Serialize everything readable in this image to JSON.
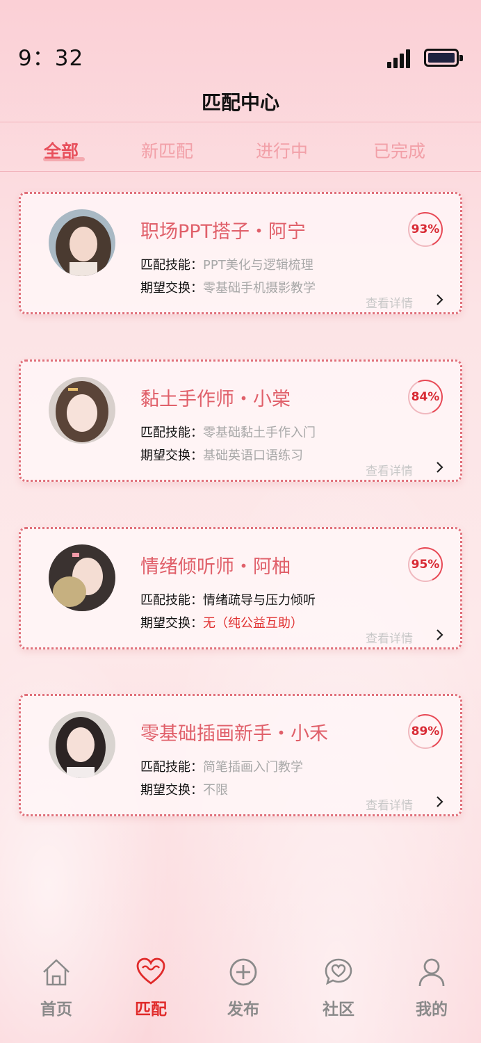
{
  "status_bar": {
    "time": "9：32"
  },
  "header": {
    "title": "匹配中心"
  },
  "tabs": [
    {
      "label": "全部",
      "active": true
    },
    {
      "label": "新匹配",
      "active": false
    },
    {
      "label": "进行中",
      "active": false
    },
    {
      "label": "已完成",
      "active": false
    }
  ],
  "cards": [
    {
      "name": "职场PPT搭子・阿宁",
      "match": "93%",
      "skill_label": "匹配技能：",
      "skill": "PPT美化与逻辑梳理",
      "exchange_label": "期望交换：",
      "exchange": "零基础手机摄影教学",
      "detail": "查看详情"
    },
    {
      "name": "黏土手作师・小棠",
      "match": "84%",
      "skill_label": "匹配技能：",
      "skill": "零基础黏土手作入门",
      "exchange_label": "期望交换：",
      "exchange": "基础英语口语练习",
      "detail": "查看详情"
    },
    {
      "name": "情绪倾听师・阿柚",
      "match": "95%",
      "skill_label": "匹配技能：",
      "skill": "情绪疏导与压力倾听",
      "exchange_label": "期望交换：",
      "exchange": "无（纯公益互助）",
      "detail": "查看详情"
    },
    {
      "name": "零基础插画新手・小禾",
      "match": "89%",
      "skill_label": "匹配技能：",
      "skill": "简笔插画入门教学",
      "exchange_label": "期望交换：",
      "exchange": "不限",
      "detail": "查看详情"
    }
  ],
  "tabbar": [
    {
      "label": "首页",
      "icon": "home-icon",
      "active": false
    },
    {
      "label": "匹配",
      "icon": "heart-icon",
      "active": true
    },
    {
      "label": "发布",
      "icon": "plus-circle-icon",
      "active": false
    },
    {
      "label": "社区",
      "icon": "chat-heart-icon",
      "active": false
    },
    {
      "label": "我的",
      "icon": "user-icon",
      "active": false
    }
  ],
  "colors": {
    "accent": "#e8505c",
    "active_tab": "#e02a2a",
    "badge": "#d82a34"
  }
}
